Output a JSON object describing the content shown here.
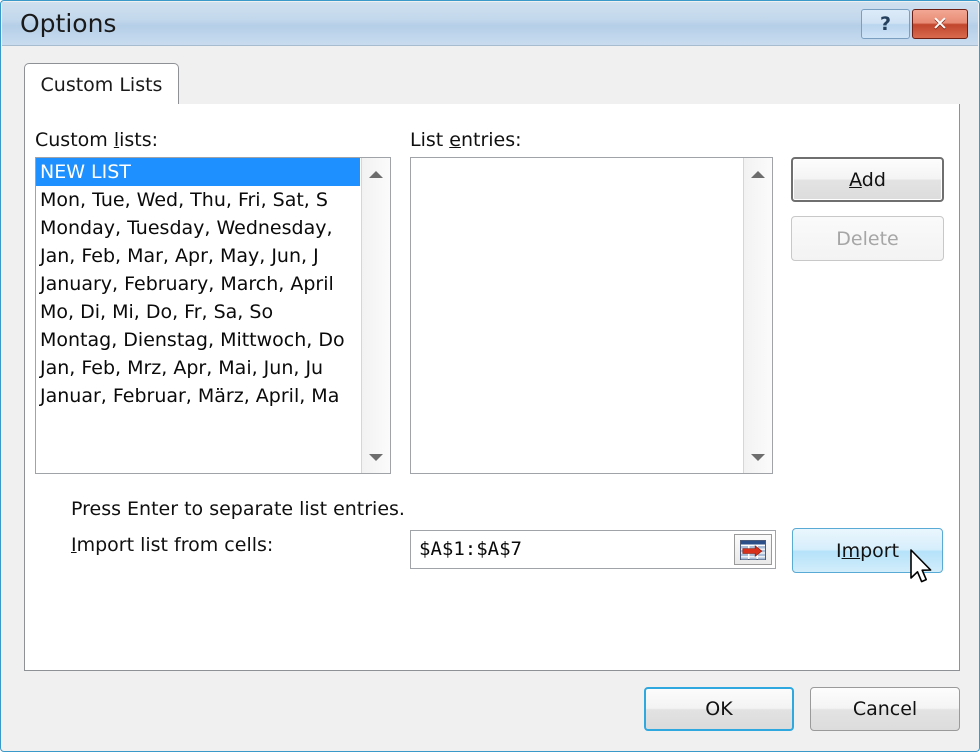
{
  "window": {
    "title": "Options",
    "help_button": "?",
    "help_icon": "question-mark-icon",
    "close_icon": "close-x-icon",
    "close_button": "✕"
  },
  "tabs": [
    {
      "label": "Custom Lists",
      "selected": true
    }
  ],
  "custom_lists": {
    "label_prefix": "Custom ",
    "label_acc": "l",
    "label_suffix": "ists:",
    "items": [
      {
        "text": "NEW LIST",
        "selected": true
      },
      {
        "text": "Mon, Tue, Wed, Thu, Fri, Sat, S",
        "selected": false
      },
      {
        "text": "Monday, Tuesday, Wednesday,",
        "selected": false
      },
      {
        "text": "Jan, Feb, Mar, Apr, May, Jun, J",
        "selected": false
      },
      {
        "text": "January, February, March, April",
        "selected": false
      },
      {
        "text": "Mo, Di, Mi, Do, Fr, Sa, So",
        "selected": false
      },
      {
        "text": "Montag, Dienstag, Mittwoch, Do",
        "selected": false
      },
      {
        "text": "Jan, Feb, Mrz, Apr, Mai, Jun, Ju",
        "selected": false
      },
      {
        "text": "Januar, Februar, März, April, Ma",
        "selected": false
      }
    ],
    "scroll_up_icon": "scroll-up-arrow-icon",
    "scroll_down_icon": "scroll-down-arrow-icon"
  },
  "list_entries": {
    "label_prefix": "List ",
    "label_acc": "e",
    "label_suffix": "ntries:",
    "items": [],
    "value": ""
  },
  "buttons": {
    "add": {
      "prefix": "",
      "acc": "A",
      "suffix": "dd",
      "enabled": true,
      "state": "focused"
    },
    "delete": {
      "prefix": "",
      "acc": "",
      "suffix": "Delete",
      "enabled": false,
      "state": "disabled"
    },
    "import": {
      "prefix": "I",
      "acc": "m",
      "suffix": "port",
      "enabled": true,
      "state": "hover"
    },
    "ok": {
      "label": "OK",
      "state": "default"
    },
    "cancel": {
      "label": "Cancel",
      "state": "normal"
    }
  },
  "import_section": {
    "hint": "Press Enter to separate list entries.",
    "label_prefix": "",
    "label_acc": "I",
    "label_suffix": "mport list from cells:",
    "range_value": "$A$1:$A$7",
    "range_placeholder": "",
    "picker_icon": "range-picker-icon"
  },
  "cursor": {
    "icon": "mouse-pointer-icon"
  },
  "colors": {
    "selection_blue": "#1e90ff",
    "titlebar_blue": "#b5cfe8",
    "close_red": "#c0452c",
    "accent_focus": "#2fa8e0",
    "window_border": "#3b99c9"
  }
}
